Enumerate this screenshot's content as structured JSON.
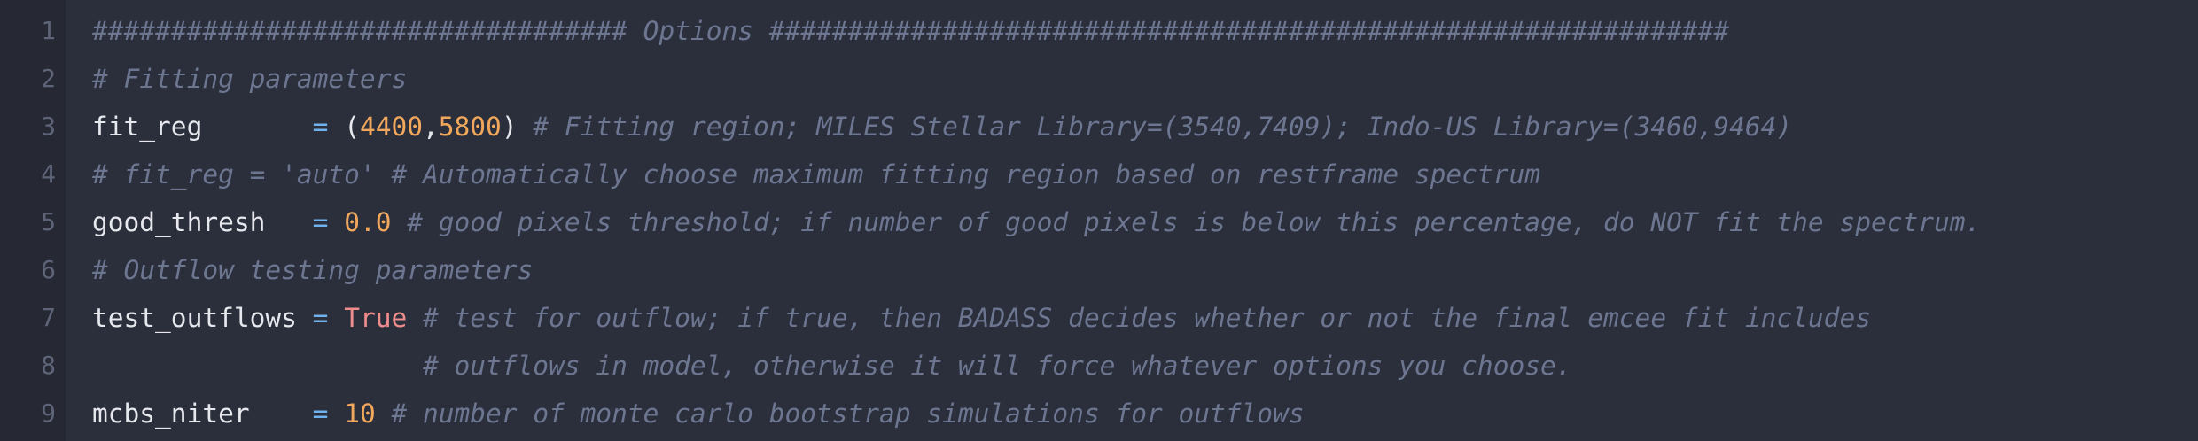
{
  "lines": [
    {
      "number": "1",
      "tokens": [
        {
          "type": "comment",
          "text": "################################## Options #############################################################"
        }
      ]
    },
    {
      "number": "2",
      "tokens": [
        {
          "type": "comment",
          "text": "# Fitting parameters"
        }
      ]
    },
    {
      "number": "3",
      "tokens": [
        {
          "type": "identifier",
          "text": "fit_reg       "
        },
        {
          "type": "operator",
          "text": "= "
        },
        {
          "type": "punct",
          "text": "("
        },
        {
          "type": "number",
          "text": "4400"
        },
        {
          "type": "punct",
          "text": ","
        },
        {
          "type": "number",
          "text": "5800"
        },
        {
          "type": "punct",
          "text": ") "
        },
        {
          "type": "comment",
          "text": "# Fitting region; MILES Stellar Library=(3540,7409); Indo-US Library=(3460,9464)"
        }
      ]
    },
    {
      "number": "4",
      "tokens": [
        {
          "type": "comment",
          "text": "# fit_reg = 'auto' # Automatically choose maximum fitting region based on restframe spectrum"
        }
      ]
    },
    {
      "number": "5",
      "tokens": [
        {
          "type": "identifier",
          "text": "good_thresh   "
        },
        {
          "type": "operator",
          "text": "= "
        },
        {
          "type": "number",
          "text": "0.0"
        },
        {
          "type": "punct",
          "text": " "
        },
        {
          "type": "comment",
          "text": "# good pixels threshold; if number of good pixels is below this percentage, do NOT fit the spectrum."
        }
      ]
    },
    {
      "number": "6",
      "tokens": [
        {
          "type": "comment",
          "text": "# Outflow testing parameters"
        }
      ]
    },
    {
      "number": "7",
      "tokens": [
        {
          "type": "identifier",
          "text": "test_outflows "
        },
        {
          "type": "operator",
          "text": "= "
        },
        {
          "type": "keyword",
          "text": "True"
        },
        {
          "type": "punct",
          "text": " "
        },
        {
          "type": "comment",
          "text": "# test for outflow; if true, then BADASS decides whether or not the final emcee fit includes"
        }
      ]
    },
    {
      "number": "8",
      "tokens": [
        {
          "type": "punct",
          "text": "                    "
        },
        {
          "type": "comment",
          "text": " # outflows in model, otherwise it will force whatever options you choose."
        }
      ]
    },
    {
      "number": "9",
      "tokens": [
        {
          "type": "identifier",
          "text": "mcbs_niter    "
        },
        {
          "type": "operator",
          "text": "= "
        },
        {
          "type": "number",
          "text": "10"
        },
        {
          "type": "punct",
          "text": " "
        },
        {
          "type": "comment",
          "text": "# number of monte carlo bootstrap simulations for outflows"
        }
      ]
    }
  ]
}
